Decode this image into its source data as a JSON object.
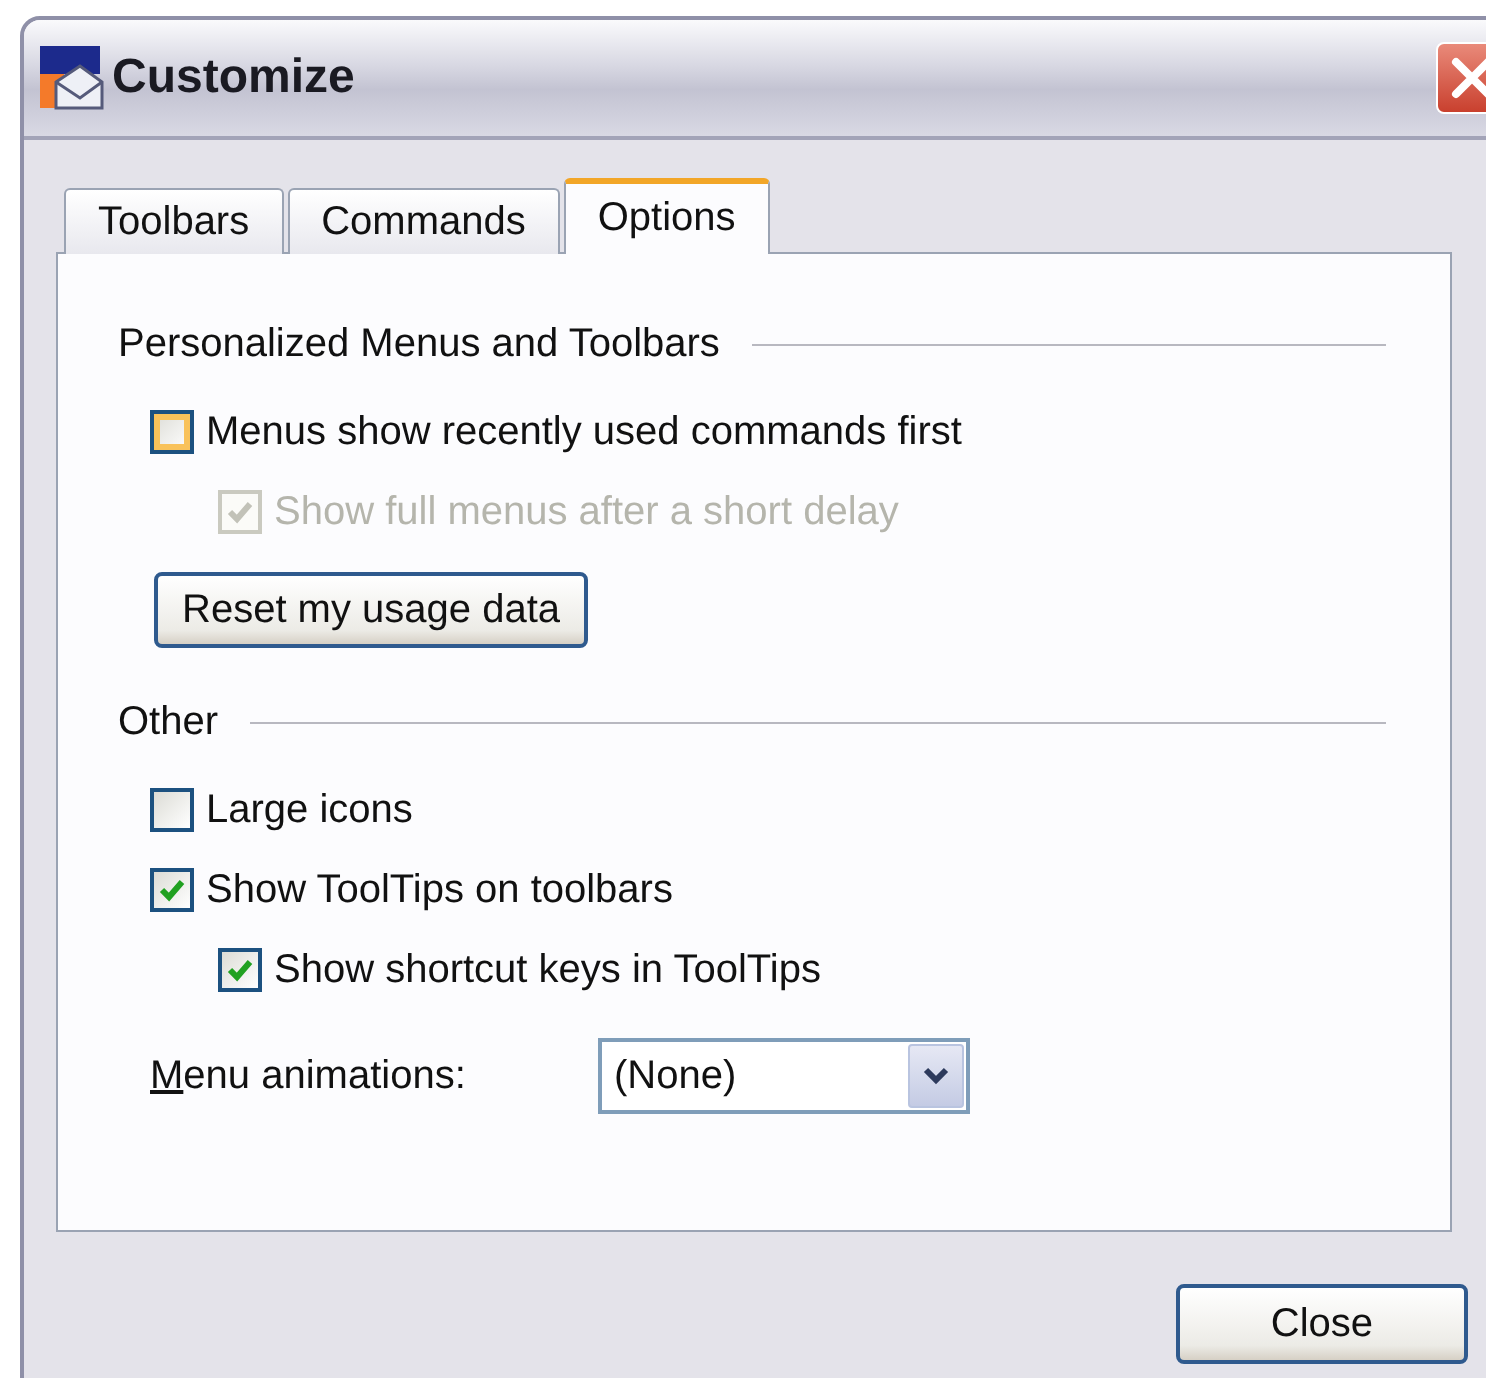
{
  "window": {
    "title": "Customize"
  },
  "tabs": [
    {
      "label": "Toolbars",
      "selected": false
    },
    {
      "label": "Commands",
      "selected": false
    },
    {
      "label": "Options",
      "selected": true
    }
  ],
  "groups": [
    {
      "title": "Personalized Menus and Toolbars",
      "items": [
        {
          "kind": "checkbox",
          "label": "Menus show recently used commands first",
          "checked": false,
          "disabled": false,
          "focused": true,
          "children": [
            {
              "kind": "checkbox",
              "label": "Show full menus after a short delay",
              "checked": true,
              "disabled": true,
              "focused": false
            }
          ]
        },
        {
          "kind": "button",
          "label": "Reset my usage data"
        }
      ]
    },
    {
      "title": "Other",
      "items": [
        {
          "kind": "checkbox",
          "label": "Large icons",
          "checked": false,
          "disabled": false,
          "focused": false
        },
        {
          "kind": "checkbox",
          "label": "Show ToolTips on toolbars",
          "checked": true,
          "disabled": false,
          "focused": false,
          "children": [
            {
              "kind": "checkbox",
              "label": "Show shortcut keys in ToolTips",
              "checked": true,
              "disabled": false,
              "focused": false
            }
          ]
        },
        {
          "kind": "dropdown",
          "label": "Menu animations:",
          "value": "(None)"
        }
      ]
    }
  ],
  "buttons": [
    "Close"
  ]
}
